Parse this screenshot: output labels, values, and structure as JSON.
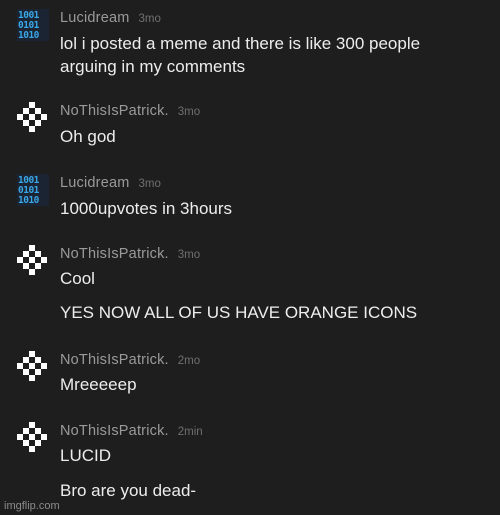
{
  "comments": [
    {
      "username": "Lucidream",
      "time": "3mo",
      "avatar_icon": "binary-avatar-icon",
      "lines": [
        "lol i posted a meme and there is like 300 people",
        "arguing in my comments"
      ]
    },
    {
      "username": "NoThisIsPatrick.",
      "time": "3mo",
      "avatar_icon": "checker-avatar-icon",
      "lines": [
        "Oh god"
      ]
    },
    {
      "username": "Lucidream",
      "time": "3mo",
      "avatar_icon": "binary-avatar-icon",
      "lines": [
        "1000upvotes in 3hours"
      ]
    },
    {
      "username": "NoThisIsPatrick.",
      "time": "3mo",
      "avatar_icon": "checker-avatar-icon",
      "lines": [
        "Cool",
        "YES NOW ALL OF US HAVE ORANGE ICONS"
      ]
    },
    {
      "username": "NoThisIsPatrick.",
      "time": "2mo",
      "avatar_icon": "checker-avatar-icon",
      "lines": [
        "Mreeeeep"
      ]
    },
    {
      "username": "NoThisIsPatrick.",
      "time": "2min",
      "avatar_icon": "checker-avatar-icon",
      "lines": [
        "LUCID",
        "Bro are you dead-"
      ]
    }
  ],
  "watermark": "imgflip.com",
  "colors": {
    "background": "#1e1e1e",
    "username": "#9a9a9a",
    "timestamp": "#6f6f6f",
    "comment_text": "#ededed",
    "binary_avatar": "#3aa7e8",
    "checker_avatar": "#ffffff"
  }
}
